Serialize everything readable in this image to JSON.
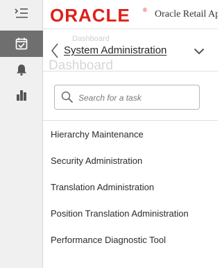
{
  "header": {
    "logo_text": "ORACLE",
    "logo_mark": "®",
    "app_title": "Oracle Retail Ap"
  },
  "background": {
    "breadcrumb": "Dashboard",
    "page_title": "Dashboard"
  },
  "rail": {
    "items": [
      {
        "icon": "menu-icon"
      },
      {
        "icon": "tasks-icon",
        "selected": true
      },
      {
        "icon": "bell-icon"
      },
      {
        "icon": "bar-chart-icon"
      }
    ]
  },
  "panel": {
    "title": "System Administration",
    "search": {
      "placeholder": "Search for a task",
      "value": ""
    },
    "tasks": [
      {
        "label": "Hierarchy Maintenance"
      },
      {
        "label": "Security Administration"
      },
      {
        "label": "Translation Administration"
      },
      {
        "label": "Position Translation Administration"
      },
      {
        "label": "Performance Diagnostic Tool"
      }
    ]
  },
  "colors": {
    "brand_red": "#e0201a",
    "rail_bg": "#f0f0f0",
    "rail_selected": "#6f6f6f"
  }
}
